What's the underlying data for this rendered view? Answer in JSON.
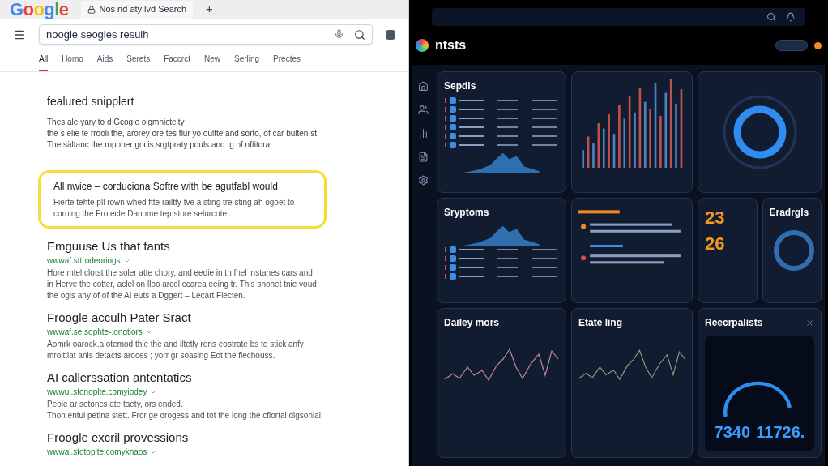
{
  "browser": {
    "logo": "Google",
    "tab_title": "Nos nd aty lvd Search",
    "new_tab": "+"
  },
  "search": {
    "value": "noogie seogles resulh"
  },
  "filters": [
    {
      "label": "All",
      "selected": true
    },
    {
      "label": "Homo",
      "selected": false
    },
    {
      "label": "Aids",
      "selected": false
    },
    {
      "label": "Serets",
      "selected": false
    },
    {
      "label": "Faccrct",
      "selected": false
    },
    {
      "label": "New",
      "selected": false
    },
    {
      "label": "Serling",
      "selected": false
    },
    {
      "label": "Prectes",
      "selected": false
    }
  ],
  "featured": {
    "title": "fealured snipplert",
    "lines": [
      "Thes ale yary to d Gcogle olgmnicteity",
      "the s elie te rrooli the, arorey ore tes flur yo oultte and sorto, of car bulten st",
      "The sältanc the ropoher gocis srgtpraty pouls and tg of oftitora."
    ]
  },
  "highlight": {
    "title": "All nwice – corduciona Softre with be agutfabl would",
    "lines": [
      "Fierte tehte pll rown whed ftte railtty tve a sting tre sting ah ogoet to",
      "coroing the Frotecle Danome tep store selurcote.."
    ]
  },
  "results": [
    {
      "title": "Emguuse Us that fants",
      "url": "wwwaf.sttrodeoriogs",
      "lines": [
        "Hore mtel clotst the soler atte chory, and eedie in th fhel instanes cars and",
        "in Herve the cotter, aclel on lloo arcel ccarea eeing tr. This snohet tnie voud",
        "the ogis any of of the AI euts a Dggert – Lecart Flecten."
      ]
    },
    {
      "title": "Froogle acculh Pater Sract",
      "url": "wwwaf.se sophte-.ongtiors",
      "lines": [
        "Aomrk oarock.a otemod thie the and iltetly rens eostrate bs to stick anfy",
        "mrolttiat anls detacts aroces ; yorr gr soasing Eot the flechouss."
      ]
    },
    {
      "title": "AI callerssation antentatics",
      "url": "wwwul.stonoplte.comyiodey",
      "lines": [
        "Peole ar sotoncs ate taety, ors ended.",
        "Thon entul petina stett. Fror ge orogess and tot the long the cflortal digsonlal."
      ]
    },
    {
      "title": "Froogle excril provessions",
      "url": "wwwal.stotoplte.comyknaos"
    }
  ],
  "dashboard": {
    "logo": "ntsts",
    "panels": {
      "list": "Sepdis",
      "symptoms": "Sryptoms",
      "daily": "Dailey mors",
      "state": "Etate ling",
      "gauge": "Reecrpalists",
      "ring": "Eradrgls"
    },
    "stats": [
      "23",
      "26"
    ],
    "readings": [
      "7340",
      "11726."
    ]
  }
}
